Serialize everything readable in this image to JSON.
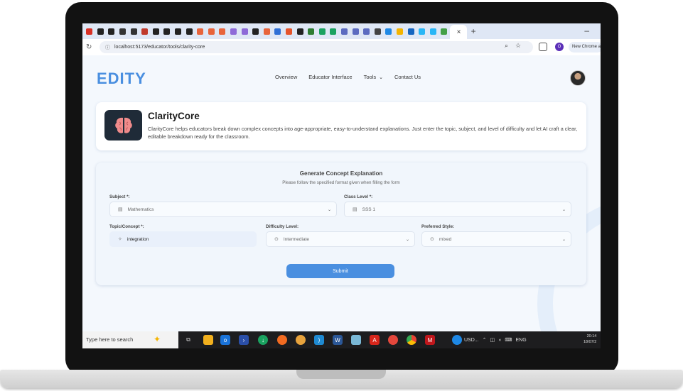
{
  "browser": {
    "tab_icons": [
      {
        "name": "gmail-icon",
        "color": "#d93025"
      },
      {
        "name": "openai-icon",
        "color": "#222222"
      },
      {
        "name": "openai-icon",
        "color": "#222222"
      },
      {
        "name": "font-icon",
        "color": "#333333"
      },
      {
        "name": "notion-icon",
        "color": "#333333"
      },
      {
        "name": "settings-icon",
        "color": "#c0392b"
      },
      {
        "name": "record-icon",
        "color": "#222222"
      },
      {
        "name": "record-icon",
        "color": "#222222"
      },
      {
        "name": "record-icon",
        "color": "#222222"
      },
      {
        "name": "github-icon",
        "color": "#222222"
      },
      {
        "name": "star-icon",
        "color": "#e8643b"
      },
      {
        "name": "star-icon",
        "color": "#e8643b"
      },
      {
        "name": "star-icon",
        "color": "#e8643b"
      },
      {
        "name": "layers-icon",
        "color": "#8e6ad8"
      },
      {
        "name": "layers-icon",
        "color": "#8e6ad8"
      },
      {
        "name": "vscode-icon",
        "color": "#222222"
      },
      {
        "name": "star-icon",
        "color": "#e8643b"
      },
      {
        "name": "box-icon",
        "color": "#2f6fd6"
      },
      {
        "name": "shield-icon",
        "color": "#e6542b"
      },
      {
        "name": "record-icon",
        "color": "#222222"
      },
      {
        "name": "cloud-icon",
        "color": "#2e7d32"
      },
      {
        "name": "check-icon",
        "color": "#1aa260"
      },
      {
        "name": "check-icon",
        "color": "#1aa260"
      },
      {
        "name": "window-icon",
        "color": "#5c6bc0"
      },
      {
        "name": "window-icon",
        "color": "#5c6bc0"
      },
      {
        "name": "window-icon",
        "color": "#5c6bc0"
      },
      {
        "name": "globe-icon",
        "color": "#444444"
      },
      {
        "name": "c-icon",
        "color": "#1e88e5"
      },
      {
        "name": "diamond-icon",
        "color": "#f4b400"
      },
      {
        "name": "image-icon",
        "color": "#1565c0"
      },
      {
        "name": "wave-icon",
        "color": "#29b6f6"
      },
      {
        "name": "wave-icon",
        "color": "#29b6f6"
      },
      {
        "name": "books-icon",
        "color": "#43a047"
      }
    ],
    "new_tab_label": "+",
    "minimize_label": "–",
    "close_tab_label": "×",
    "url": "localhost:5173/educator/tools/clarity-core",
    "profile_initial": "O",
    "new_chrome_label": "New Chrome a"
  },
  "nav": {
    "logo": "EDITY",
    "items": [
      "Overview",
      "Educator Interface",
      "Tools",
      "Contact Us"
    ]
  },
  "tool": {
    "name": "ClarityCore",
    "description": "ClarityCore helps educators break down complex concepts into age-appropriate, easy-to-understand explanations. Just enter the topic, subject, and level of difficulty and let AI craft a clear, editable breakdown ready for the classroom."
  },
  "form": {
    "title": "Generate Concept Explanation",
    "subtitle": "Please follow the specified format given when filling the form",
    "subject_label": "Subject *:",
    "subject_value": "Mathematics",
    "class_label": "Class Level *:",
    "class_value": "SSS 1",
    "topic_label": "Topic/Concept *:",
    "topic_value": "integration",
    "difficulty_label": "Difficulty Level:",
    "difficulty_value": "Intermediate",
    "style_label": "Preferred Style:",
    "style_value": "mixed",
    "submit_label": "Submit"
  },
  "taskbar": {
    "search_placeholder": "Type here to search",
    "tray_text": "USD...",
    "lang": "ENG",
    "time": "20:14",
    "date": "18/07/2"
  },
  "colors": {
    "accent": "#4a8fe0",
    "brain": "#f08b8b",
    "icon_bg": "#1f2b38"
  }
}
